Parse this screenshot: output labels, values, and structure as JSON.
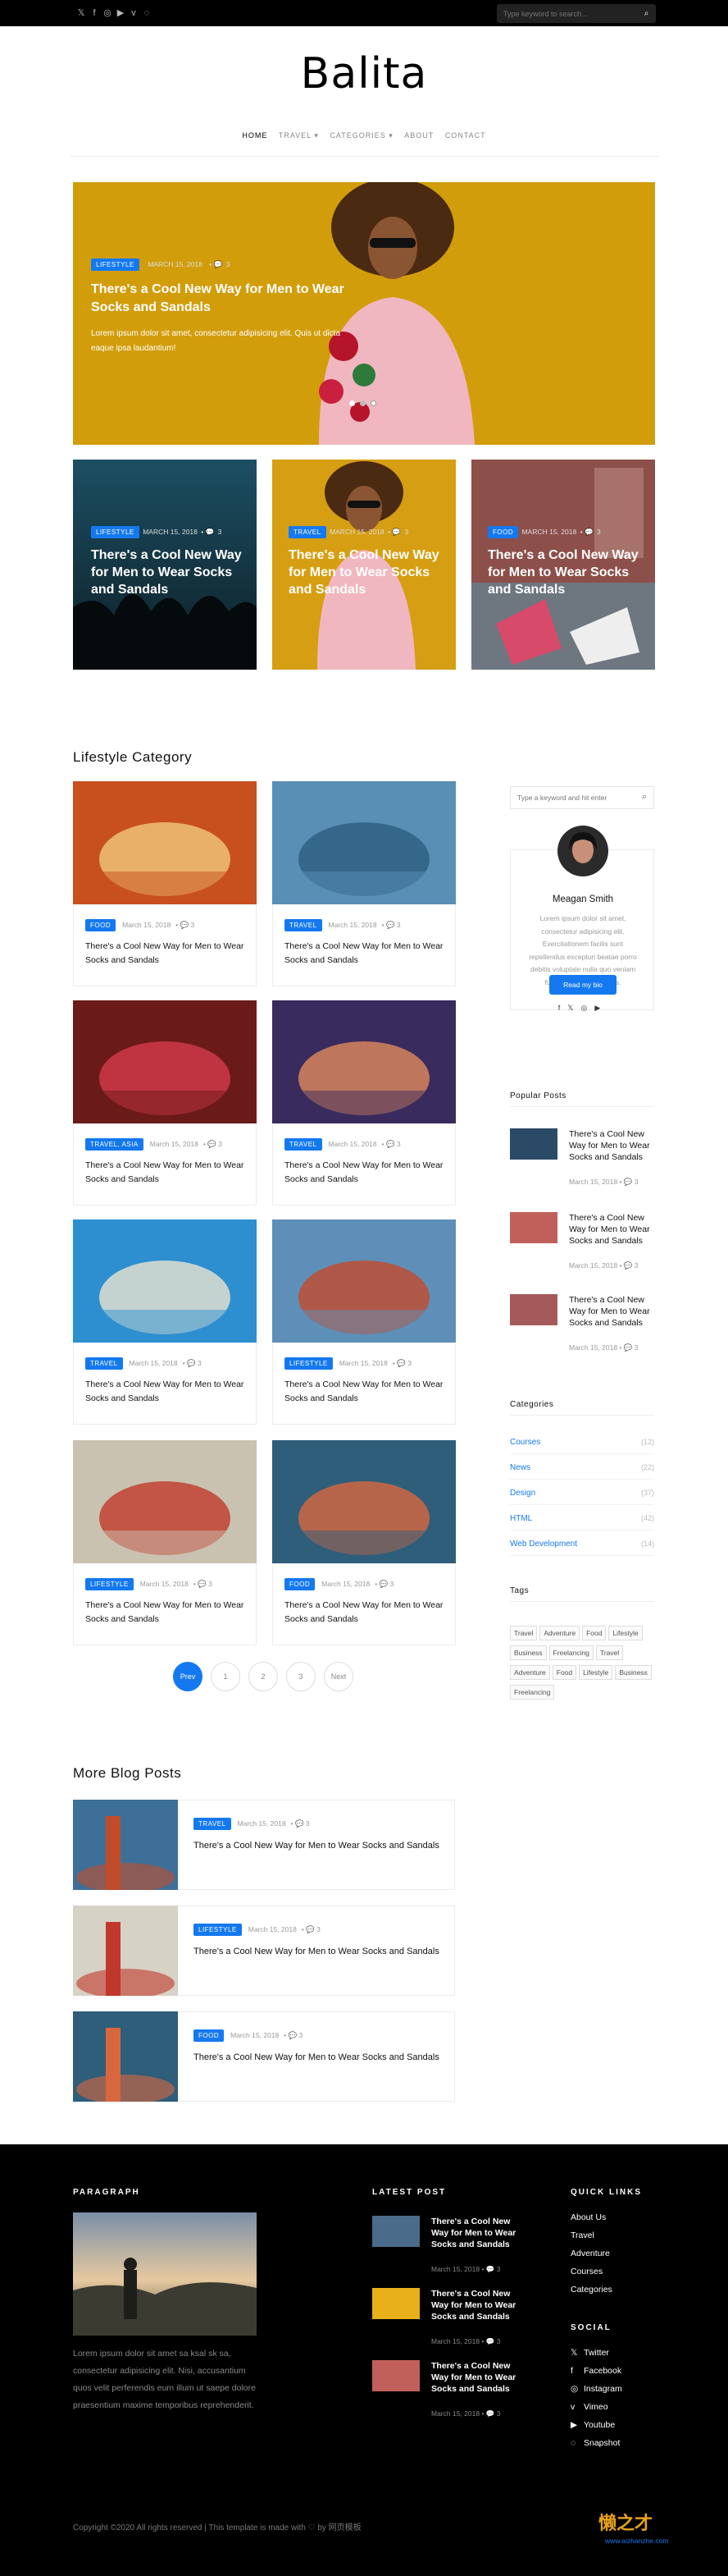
{
  "topbar": {
    "social_icons": [
      "twitter-icon",
      "facebook-icon",
      "instagram-icon",
      "youtube-icon",
      "vimeo-icon",
      "snapchat-icon"
    ],
    "social_glyphs": [
      "𝕏",
      "f",
      "◎",
      "▶",
      "v",
      "◌"
    ],
    "search_placeholder": "Type keyword to search...",
    "search_icon": "⌕"
  },
  "site": {
    "logo": "Balita"
  },
  "nav": {
    "items": [
      "HOME",
      "TRAVEL ▾",
      "CATEGORIES ▾",
      "ABOUT",
      "CONTACT"
    ]
  },
  "hero": {
    "badge": "LIFESTYLE",
    "date": "MARCH 15, 2018",
    "comments": "3",
    "title": "There's a Cool New Way for Men to Wear Socks and Sandals",
    "excerpt": "Lorem ipsum dolor sit amet, consectetur adipisicing elit. Quis ut dicta eaque ipsa laudantium!"
  },
  "cards": [
    {
      "badge": "LIFESTYLE",
      "date": "MARCH 15, 2018",
      "comments": "3",
      "title": "There's a Cool New Way for Men to Wear Socks and Sandals"
    },
    {
      "badge": "TRAVEL",
      "date": "MARCH 15, 2018",
      "comments": "3",
      "title": "There's a Cool New Way for Men to Wear Socks and Sandals"
    },
    {
      "badge": "FOOD",
      "date": "MARCH 15, 2018",
      "comments": "3",
      "title": "There's a Cool New Way for Men to Wear Socks and Sandals"
    }
  ],
  "lifestyle": {
    "title": "Lifestyle Category",
    "posts": [
      {
        "badge": "FOOD",
        "date": "March 15, 2018",
        "comments": "3",
        "title": "There's a Cool New Way for Men to Wear Socks and Sandals"
      },
      {
        "badge": "TRAVEL",
        "date": "March 15, 2018",
        "comments": "3",
        "title": "There's a Cool New Way for Men to Wear Socks and Sandals"
      },
      {
        "badge": "TRAVEL, ASIA",
        "date": "March 15, 2018",
        "comments": "3",
        "title": "There's a Cool New Way for Men to Wear Socks and Sandals"
      },
      {
        "badge": "TRAVEL",
        "date": "March 15, 2018",
        "comments": "3",
        "title": "There's a Cool New Way for Men to Wear Socks and Sandals"
      },
      {
        "badge": "TRAVEL",
        "date": "March 15, 2018",
        "comments": "3",
        "title": "There's a Cool New Way for Men to Wear Socks and Sandals"
      },
      {
        "badge": "LIFESTYLE",
        "date": "March 15, 2018",
        "comments": "3",
        "title": "There's a Cool New Way for Men to Wear Socks and Sandals"
      },
      {
        "badge": "LIFESTYLE",
        "date": "March 15, 2018",
        "comments": "3",
        "title": "There's a Cool New Way for Men to Wear Socks and Sandals"
      },
      {
        "badge": "FOOD",
        "date": "March 15, 2018",
        "comments": "3",
        "title": "There's a Cool New Way for Men to Wear Socks and Sandals"
      }
    ],
    "pagination": [
      "Prev",
      "1",
      "2",
      "3",
      "Next"
    ]
  },
  "sidebar": {
    "search_placeholder": "Type a keyword and hit enter",
    "author": {
      "name": "Meagan Smith",
      "bio": "Lorem ipsum dolor sit amet, consectetur adipisicing elit. Exercitationem facilis sunt repellendus excepturi beatae porro debitis voluptate nulla quo veniam fuga sit molestias minus.",
      "button": "Read my bio",
      "social_glyphs": [
        "f",
        "𝕏",
        "◎",
        "▶"
      ]
    },
    "popular_title": "Popular Posts",
    "popular": [
      {
        "title": "There's a Cool New Way for Men to Wear Socks and Sandals",
        "date": "March 15, 2018",
        "comments": "3"
      },
      {
        "title": "There's a Cool New Way for Men to Wear Socks and Sandals",
        "date": "March 15, 2018",
        "comments": "3"
      },
      {
        "title": "There's a Cool New Way for Men to Wear Socks and Sandals",
        "date": "March 15, 2018",
        "comments": "3"
      }
    ],
    "categories_title": "Categories",
    "categories": [
      {
        "name": "Courses",
        "count": "(12)"
      },
      {
        "name": "News",
        "count": "(22)"
      },
      {
        "name": "Design",
        "count": "(37)"
      },
      {
        "name": "HTML",
        "count": "(42)"
      },
      {
        "name": "Web Development",
        "count": "(14)"
      }
    ],
    "tags_title": "Tags",
    "tags": [
      "Travel",
      "Adventure",
      "Food",
      "Lifestyle",
      "Business",
      "Freelancing",
      "Travel",
      "Adventure",
      "Food",
      "Lifestyle",
      "Business",
      "Freelancing"
    ]
  },
  "more": {
    "title": "More Blog Posts",
    "posts": [
      {
        "badge": "TRAVEL",
        "date": "March 15, 2018",
        "comments": "3",
        "title": "There's a Cool New Way for Men to Wear Socks and Sandals"
      },
      {
        "badge": "LIFESTYLE",
        "date": "March 15, 2018",
        "comments": "3",
        "title": "There's a Cool New Way for Men to Wear Socks and Sandals"
      },
      {
        "badge": "FOOD",
        "date": "March 15, 2018",
        "comments": "3",
        "title": "There's a Cool New Way for Men to Wear Socks and Sandals"
      }
    ]
  },
  "footer": {
    "paragraph_title": "PARAGRAPH",
    "paragraph_text": "Lorem ipsum dolor sit amet sa ksal sk sa, consectetur adipisicing elit. Nisi, accusantium quos velit perferendis eum illum ut saepe dolore praesentium maxime temporibus reprehenderit.",
    "latest_title": "LATEST POST",
    "latest": [
      {
        "title": "There's a Cool New Way for Men to Wear Socks and Sandals",
        "date": "March 15, 2018",
        "comments": "3"
      },
      {
        "title": "There's a Cool New Way for Men to Wear Socks and Sandals",
        "date": "March 15, 2018",
        "comments": "3"
      },
      {
        "title": "There's a Cool New Way for Men to Wear Socks and Sandals",
        "date": "March 15, 2018",
        "comments": "3"
      }
    ],
    "quick_title": "QUICK LINKS",
    "quick_links": [
      "About Us",
      "Travel",
      "Adventure",
      "Courses",
      "Categories"
    ],
    "social_title": "SOCIAL",
    "social": [
      {
        "icon": "𝕏",
        "label": "Twitter"
      },
      {
        "icon": "f",
        "label": "Facebook"
      },
      {
        "icon": "◎",
        "label": "Instagram"
      },
      {
        "icon": "v",
        "label": "Vimeo"
      },
      {
        "icon": "▶",
        "label": "Youtube"
      },
      {
        "icon": "◌",
        "label": "Snapshot"
      }
    ],
    "copyright": "Copyright ©2020 All rights reserved | This template is made with ♡ by 网页模板",
    "watermark_main": "懒之才",
    "watermark_sub": "www.aizhanzhe.com"
  },
  "colors": {
    "accent": "#1479f0",
    "footer_bg": "#000000",
    "hero_bg": "#d8a20e"
  }
}
